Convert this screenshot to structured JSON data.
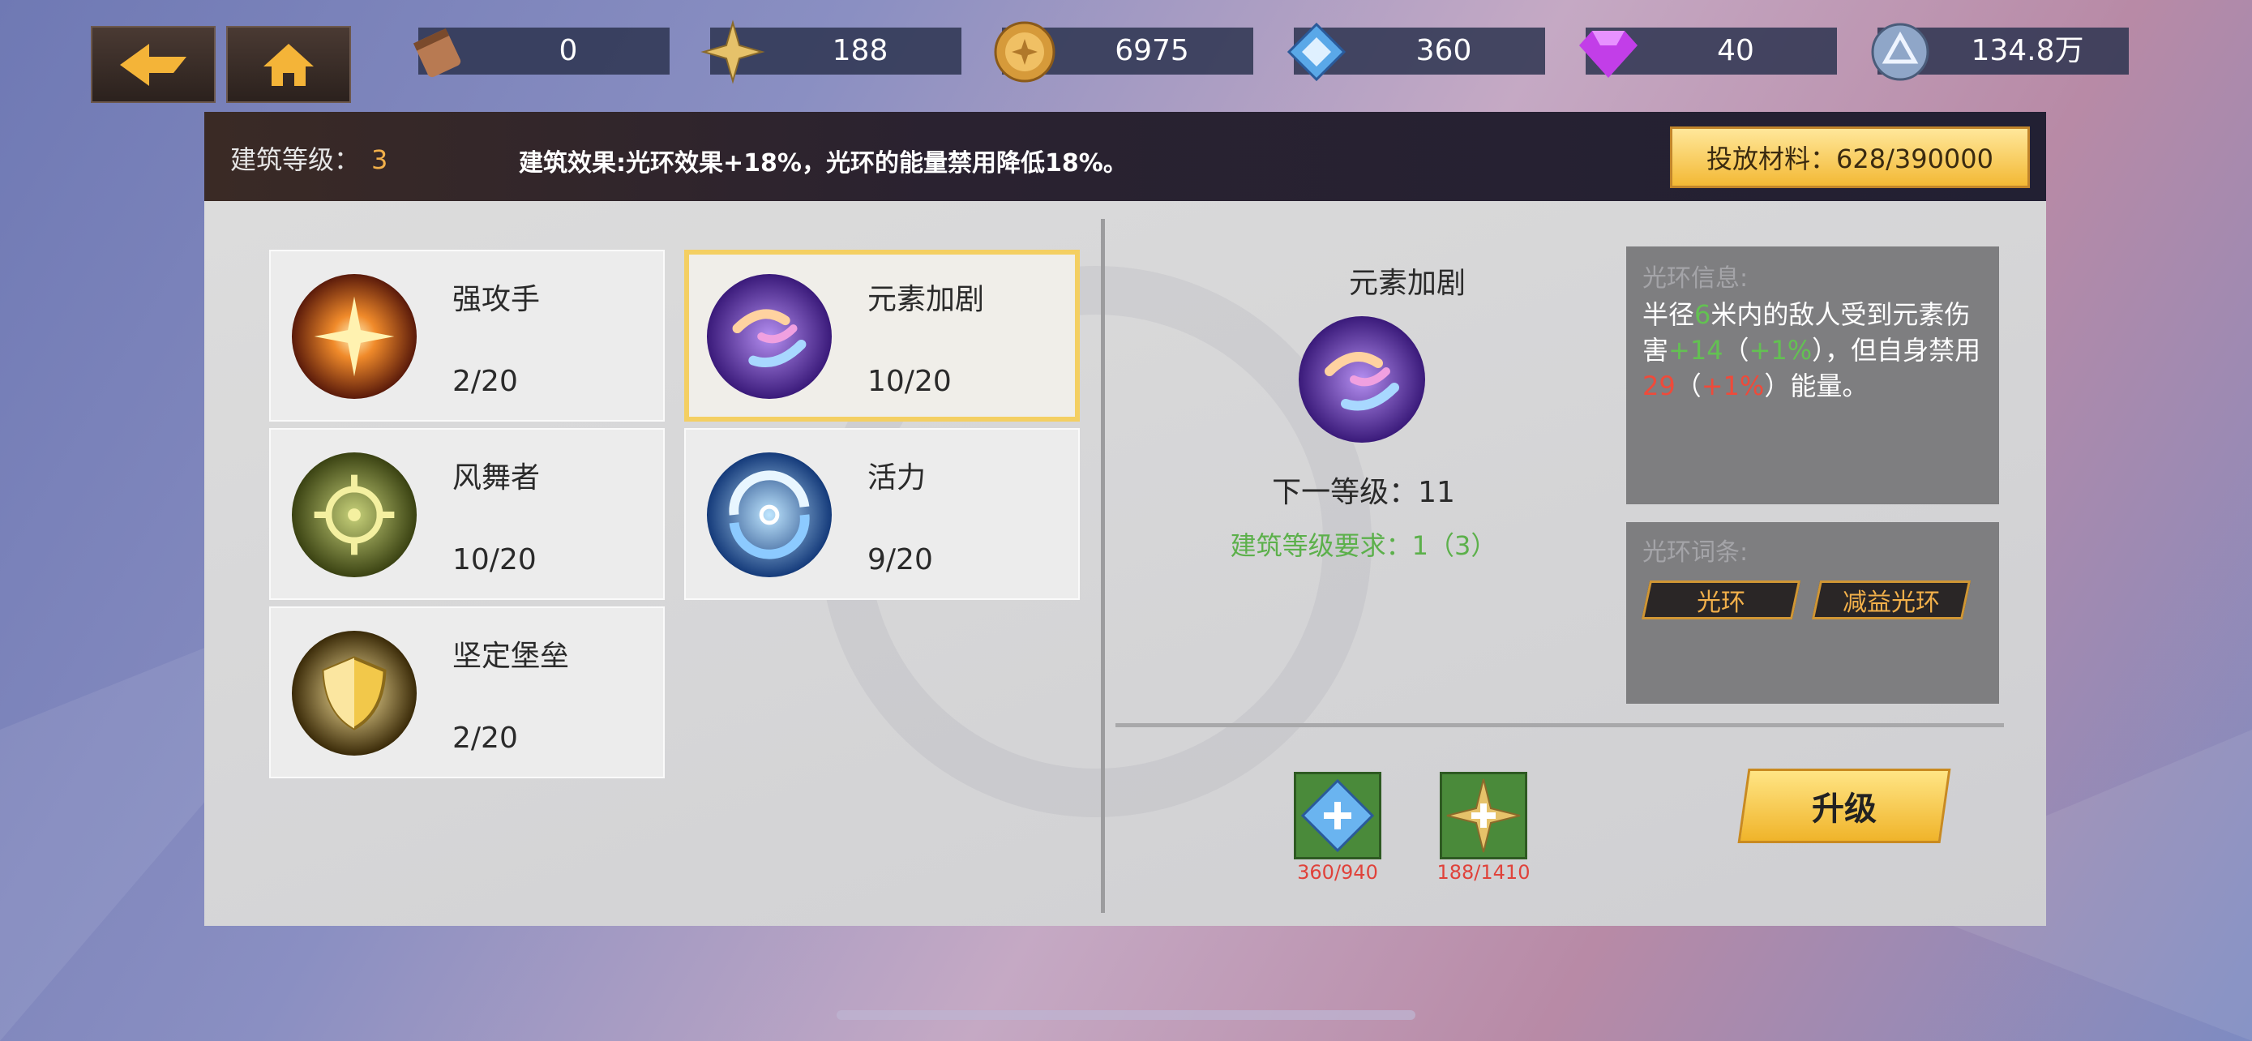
{
  "topbar": {
    "resources": [
      {
        "icon": "scroll-icon",
        "value": "0"
      },
      {
        "icon": "gold-star-icon",
        "value": "188"
      },
      {
        "icon": "gold-coin-icon",
        "value": "6975"
      },
      {
        "icon": "blue-medal-icon",
        "value": "360"
      },
      {
        "icon": "purple-diamond-icon",
        "value": "40"
      },
      {
        "icon": "silver-orb-icon",
        "value": "134.8万"
      }
    ]
  },
  "header": {
    "level_label": "建筑等级：",
    "level_value": "3",
    "effect": "建筑效果:光环效果+18%，光环的能量禁用降低18%。",
    "material_label": "投放材料：628/390000"
  },
  "skills": [
    {
      "name": "强攻手",
      "level": "2/20",
      "icon": "strike-icon",
      "selected": false
    },
    {
      "name": "元素加剧",
      "level": "10/20",
      "icon": "element-swirl-icon",
      "selected": true
    },
    {
      "name": "风舞者",
      "level": "10/20",
      "icon": "crosshair-icon",
      "selected": false
    },
    {
      "name": "活力",
      "level": "9/20",
      "icon": "vortex-icon",
      "selected": false
    },
    {
      "name": "坚定堡垒",
      "level": "2/20",
      "icon": "shield-icon",
      "selected": false
    }
  ],
  "detail": {
    "name": "元素加剧",
    "next_level": "下一等级：11",
    "requirement": "建筑等级要求：1（3）",
    "info_title": "光环信息:",
    "info": {
      "p1": "半径",
      "radius": "6",
      "p2": "米内的敌人受到元素伤害",
      "dmg": "+14",
      "p3": "（",
      "dmg_inc": "+1%",
      "p4": "），但自身禁用",
      "energy": "29",
      "p5": "（",
      "energy_inc": "+1%",
      "p6": "）能量。"
    },
    "tags_title": "光环词条:",
    "tags": [
      "光环",
      "减益光环"
    ]
  },
  "costs": [
    {
      "icon": "blue-medal-plus-icon",
      "value": "360/940"
    },
    {
      "icon": "gold-star-plus-icon",
      "value": "188/1410"
    }
  ],
  "upgrade_label": "升级",
  "colors": {
    "accent_gold": "#f2b04a",
    "green": "#63c152",
    "red": "#ef4a3a"
  }
}
